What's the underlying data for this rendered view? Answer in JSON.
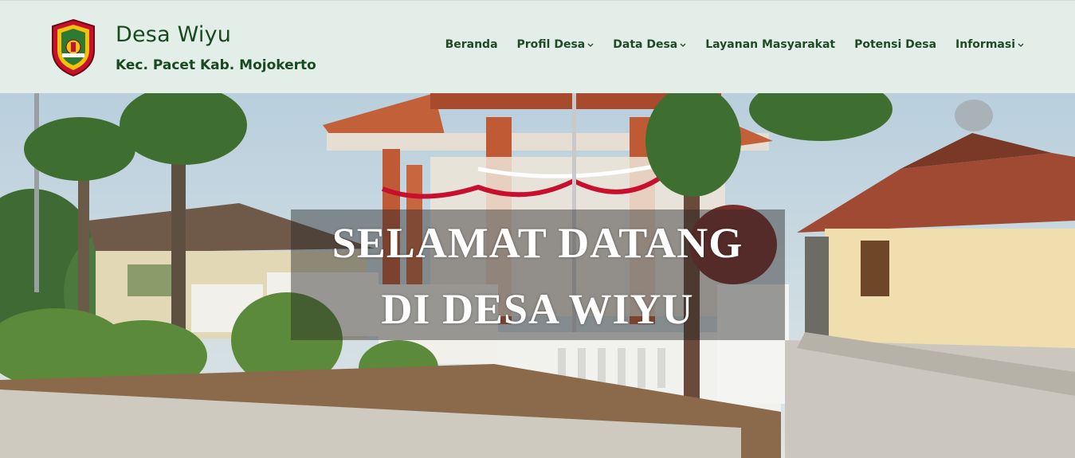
{
  "header": {
    "site_title": "Desa Wiyu",
    "site_subtitle": "Kec. Pacet Kab. Mojokerto",
    "logo_icon": "regency-emblem-icon"
  },
  "nav": {
    "items": [
      {
        "label": "Beranda",
        "has_dropdown": false
      },
      {
        "label": "Profil Desa",
        "has_dropdown": true
      },
      {
        "label": "Data Desa",
        "has_dropdown": true
      },
      {
        "label": "Layanan Masyarakat",
        "has_dropdown": false
      },
      {
        "label": "Potensi Desa",
        "has_dropdown": false
      },
      {
        "label": "Informasi",
        "has_dropdown": true
      }
    ]
  },
  "hero": {
    "line1": "SELAMAT DATANG",
    "line2": "DI DESA WIYU"
  },
  "colors": {
    "header_bg": "#e4eee8",
    "brand_green": "#184a1f",
    "nav_text": "#1f4a25",
    "hero_text": "#ffffff"
  }
}
